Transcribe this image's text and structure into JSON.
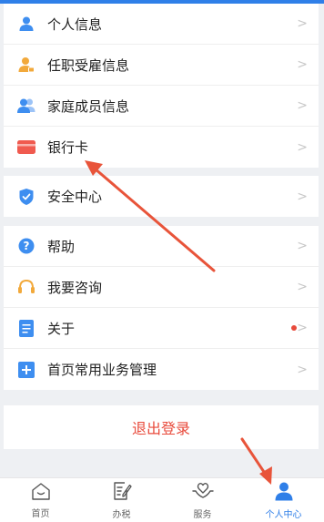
{
  "menu": {
    "group1": [
      {
        "label": "个人信息",
        "icon": "person-icon"
      },
      {
        "label": "任职受雇信息",
        "icon": "employee-icon"
      },
      {
        "label": "家庭成员信息",
        "icon": "family-icon"
      },
      {
        "label": "银行卡",
        "icon": "bank-card-icon"
      }
    ],
    "group2": [
      {
        "label": "安全中心",
        "icon": "shield-icon"
      }
    ],
    "group3": [
      {
        "label": "帮助",
        "icon": "help-icon"
      },
      {
        "label": "我要咨询",
        "icon": "headset-icon"
      },
      {
        "label": "关于",
        "icon": "document-icon"
      },
      {
        "label": "首页常用业务管理",
        "icon": "plus-icon"
      }
    ],
    "chevron": ">"
  },
  "logout_label": "退出登录",
  "tabbar": {
    "home": "首页",
    "tax": "办税",
    "service": "服务",
    "personal": "个人中心"
  },
  "colors": {
    "accent": "#2f7fe8",
    "danger": "#e84a3b",
    "annotation_arrow": "#e8543a"
  }
}
